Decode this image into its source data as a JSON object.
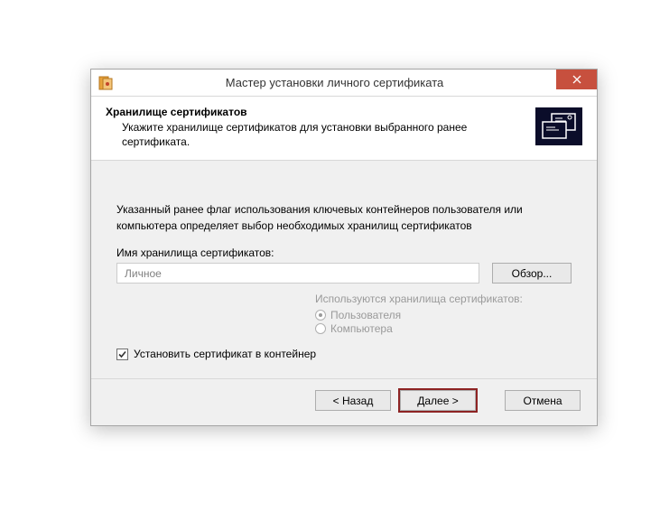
{
  "window": {
    "title": "Мастер установки личного сертификата"
  },
  "header": {
    "title": "Хранилище сертификатов",
    "subtitle": "Укажите хранилище сертификатов для установки выбранного ранее сертификата."
  },
  "body": {
    "info_text": "Указанный ранее флаг использования ключевых контейнеров пользователя или компьютера определяет выбор необходимых хранилищ сертификатов",
    "store_name_label": "Имя хранилища сертификатов:",
    "store_name_value": "Личное",
    "browse_label": "Обзор...",
    "radio_group_label": "Используются хранилища сертификатов:",
    "radio_user": "Пользователя",
    "radio_computer": "Компьютера",
    "install_to_container_label": "Установить сертификат в контейнер"
  },
  "footer": {
    "back": "< Назад",
    "next": "Далее >",
    "cancel": "Отмена"
  }
}
